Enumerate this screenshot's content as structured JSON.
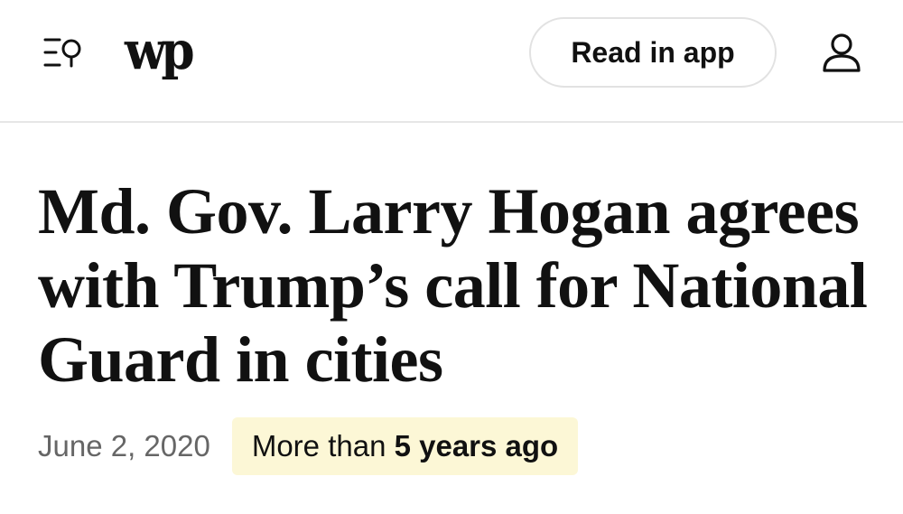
{
  "header": {
    "logo_text": "wp",
    "read_in_app_label": "Read in app",
    "icons": {
      "menu": "menu-search-icon",
      "user": "user-account-icon"
    }
  },
  "article": {
    "headline": "Md. Gov. Larry Hogan agrees with Trump’s call for National Guard in cities",
    "date": "June 2, 2020",
    "age_prefix": "More than ",
    "age_value": "5 years ago"
  },
  "colors": {
    "badge_background": "#fcf7d6",
    "divider": "#e6e6e6",
    "date_text": "#666666"
  }
}
